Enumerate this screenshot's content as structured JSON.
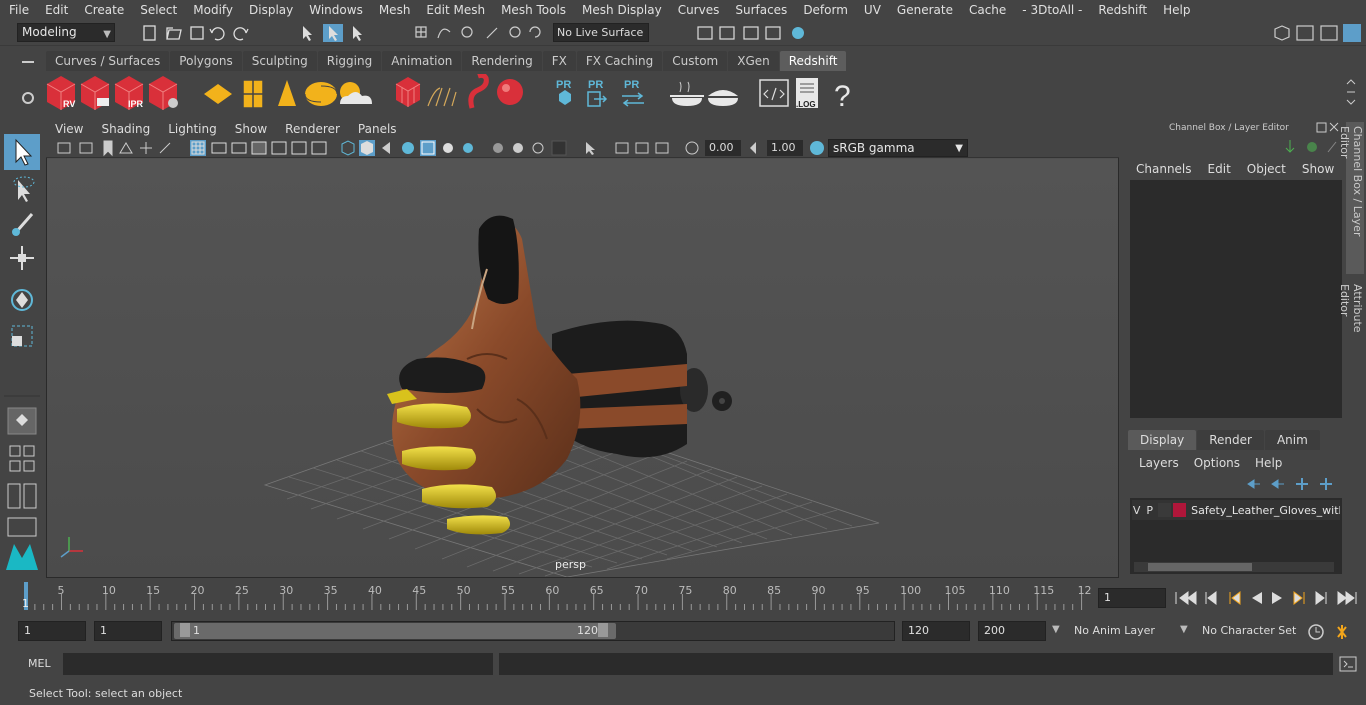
{
  "menus": [
    "File",
    "Edit",
    "Create",
    "Select",
    "Modify",
    "Display",
    "Windows",
    "Mesh",
    "Edit Mesh",
    "Mesh Tools",
    "Mesh Display",
    "Curves",
    "Surfaces",
    "Deform",
    "UV",
    "Generate",
    "Cache",
    "- 3DtoAll -",
    "Redshift",
    "Help"
  ],
  "status": {
    "mode": "Modeling",
    "live_surface": "No Live Surface"
  },
  "shelf_tabs": [
    "Curves / Surfaces",
    "Polygons",
    "Sculpting",
    "Rigging",
    "Animation",
    "Rendering",
    "FX",
    "FX Caching",
    "Custom",
    "XGen",
    "Redshift"
  ],
  "active_shelf_tab": "Redshift",
  "shelf_icon_labels": {
    "rv": "RV",
    "ipr": "IPR",
    "pr": "PR",
    "log": ".LOG",
    "help": "?"
  },
  "viewport": {
    "menus": [
      "View",
      "Shading",
      "Lighting",
      "Show",
      "Renderer",
      "Panels"
    ],
    "exposure": "0.00",
    "gamma_value": "1.00",
    "color_space": "sRGB gamma",
    "camera": "persp"
  },
  "channel_box": {
    "title": "Channel Box / Layer Editor",
    "menus": [
      "Channels",
      "Edit",
      "Object",
      "Show"
    ],
    "layer_tabs": [
      "Display",
      "Render",
      "Anim"
    ],
    "active_layer_tab": "Display",
    "layer_menus": [
      "Layers",
      "Options",
      "Help"
    ],
    "layer": {
      "v": "V",
      "p": "P",
      "name": "Safety_Leather_Gloves_with_",
      "color": "#b0163a"
    }
  },
  "side_tabs": [
    "Channel Box / Layer Editor",
    "Attribute Editor"
  ],
  "timeline": {
    "ticks": [
      "5",
      "10",
      "15",
      "20",
      "25",
      "30",
      "35",
      "40",
      "45",
      "50",
      "55",
      "60",
      "65",
      "70",
      "75",
      "80",
      "85",
      "90",
      "95",
      "100",
      "105",
      "110",
      "115",
      "12"
    ],
    "current_frame": "1",
    "frame_indicator": "1"
  },
  "range": {
    "start": "1",
    "start2": "1",
    "slider_min": "1",
    "slider_max": "120",
    "end": "120",
    "end2": "200",
    "anim_layer": "No Anim Layer",
    "char_set": "No Character Set"
  },
  "mel": {
    "label": "MEL"
  },
  "help_line": "Select Tool: select an object",
  "colors": {
    "accent": "#5d9ec9",
    "redshift_red": "#d9303a",
    "glove_brown": "#8a4a2a",
    "glove_yellow": "#d8c21c"
  }
}
